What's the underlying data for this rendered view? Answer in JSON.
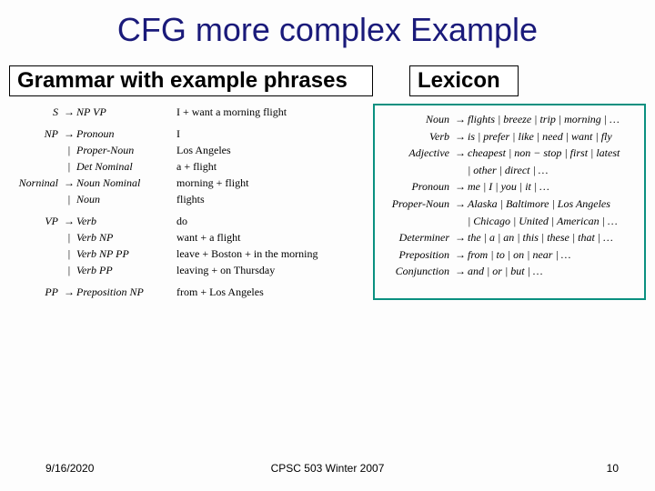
{
  "title": "CFG more complex Example",
  "subheads": {
    "left": "Grammar with example phrases",
    "right": "Lexicon"
  },
  "grammar": {
    "rules": [
      {
        "lhs": "S",
        "arrow": "→",
        "rhs": "NP VP",
        "gap_after": true
      },
      {
        "lhs": "NP",
        "arrow": "→",
        "rhs": "Pronoun"
      },
      {
        "lhs": "",
        "arrow": "|",
        "rhs": "Proper-Noun"
      },
      {
        "lhs": "",
        "arrow": "|",
        "rhs": "Det Nominal"
      },
      {
        "lhs": "Norninal",
        "arrow": "→",
        "rhs": "Noun Nominal"
      },
      {
        "lhs": "",
        "arrow": "|",
        "rhs": "Noun",
        "gap_after": true
      },
      {
        "lhs": "VP",
        "arrow": "→",
        "rhs": "Verb"
      },
      {
        "lhs": "",
        "arrow": "|",
        "rhs": "Verb NP"
      },
      {
        "lhs": "",
        "arrow": "|",
        "rhs": "Verb NP PP"
      },
      {
        "lhs": "",
        "arrow": "|",
        "rhs": "Verb PP",
        "gap_after": true
      },
      {
        "lhs": "PP",
        "arrow": "→",
        "rhs": "Preposition NP"
      }
    ],
    "examples": [
      {
        "text": "I + want a morning flight",
        "gap_after": true
      },
      {
        "text": "I"
      },
      {
        "text": "Los Angeles"
      },
      {
        "text": "a + flight"
      },
      {
        "text": "morning + flight"
      },
      {
        "text": "flights",
        "gap_after": true
      },
      {
        "text": "do"
      },
      {
        "text": "want + a flight"
      },
      {
        "text": "leave + Boston + in the morning"
      },
      {
        "text": "leaving + on Thursday",
        "gap_after": true
      },
      {
        "text": "from + Los Angeles"
      }
    ]
  },
  "lexicon": [
    {
      "lhs": "Noun",
      "rhs": "flights | breeze | trip | morning | …"
    },
    {
      "lhs": "Verb",
      "rhs": "is | prefer | like | need | want | fly"
    },
    {
      "lhs": "Adjective",
      "rhs": "cheapest | non − stop | first | latest",
      "cont": "| other | direct | …"
    },
    {
      "lhs": "Pronoun",
      "rhs": "me | I | you | it | …"
    },
    {
      "lhs": "Proper-Noun",
      "rhs": "Alaska | Baltimore | Los Angeles",
      "cont": "| Chicago | United | American | …"
    },
    {
      "lhs": "Determiner",
      "rhs": "the | a | an | this | these | that | …"
    },
    {
      "lhs": "Preposition",
      "rhs": "from | to | on | near | …"
    },
    {
      "lhs": "Conjunction",
      "rhs": "and | or | but | …"
    }
  ],
  "footer": {
    "left": "9/16/2020",
    "center": "CPSC 503 Winter 2007",
    "right": "10"
  }
}
